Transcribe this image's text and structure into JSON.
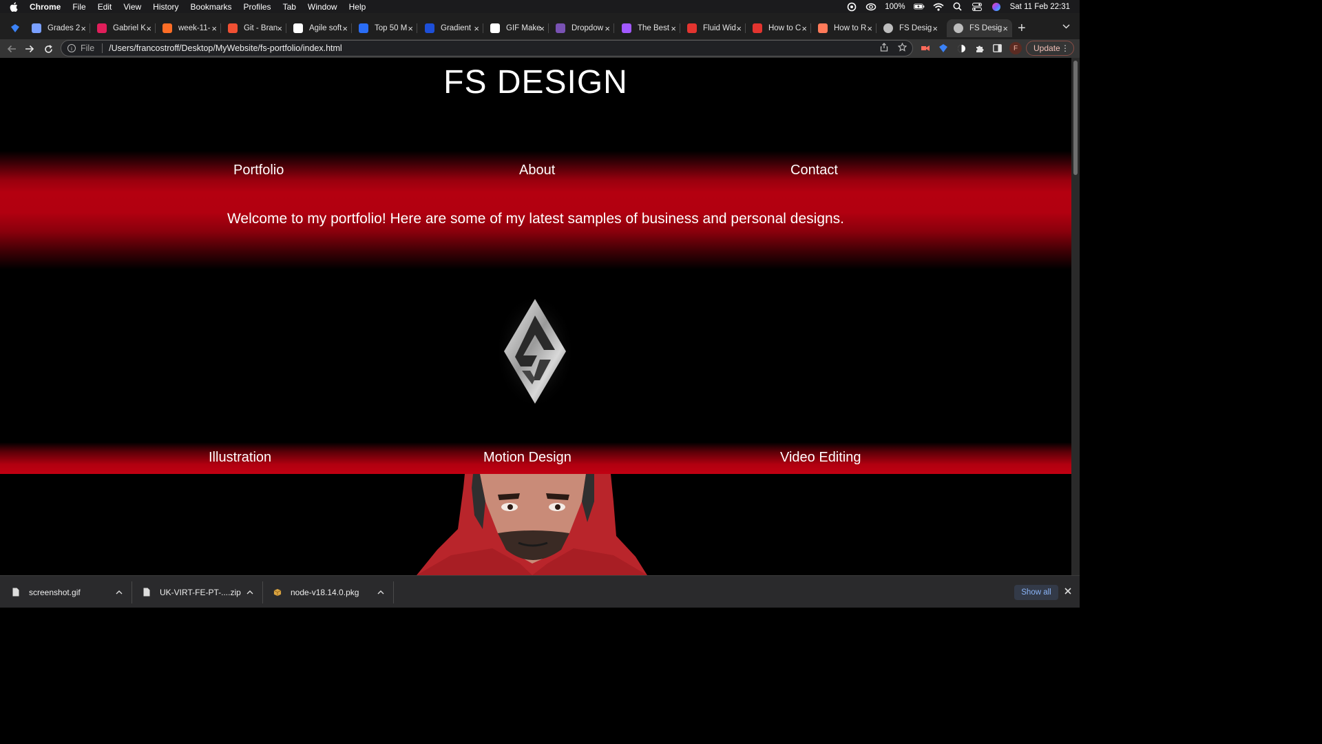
{
  "menubar": {
    "app": "Chrome",
    "items": [
      "File",
      "Edit",
      "View",
      "History",
      "Bookmarks",
      "Profiles",
      "Tab",
      "Window",
      "Help"
    ],
    "battery": "100%",
    "datetime": "Sat 11 Feb  22:31"
  },
  "tabs": [
    {
      "title": "Grades 2",
      "icon": "ox-icon",
      "color": "#7aa0ff"
    },
    {
      "title": "Gabriel K",
      "icon": "slack-icon",
      "color": "#e01e5a"
    },
    {
      "title": "week-11-",
      "icon": "gitlab-icon",
      "color": "#fc6d26"
    },
    {
      "title": "Git - Bran",
      "icon": "git-icon",
      "color": "#f05033"
    },
    {
      "title": "Agile soft",
      "icon": "wikipedia-icon",
      "color": "#ffffff"
    },
    {
      "title": "Top 50 M",
      "icon": "q-icon",
      "color": "#2a6df5"
    },
    {
      "title": "Gradient",
      "icon": "gradient-icon",
      "color": "#1d4fd8"
    },
    {
      "title": "GIF Make",
      "icon": "doc-icon",
      "color": "#ffffff"
    },
    {
      "title": "Dropdow",
      "icon": "bootstrap-icon",
      "color": "#7952b3"
    },
    {
      "title": "The Best",
      "icon": "figma-icon",
      "color": "#a259ff"
    },
    {
      "title": "Fluid Wid",
      "icon": "asterisk-icon",
      "color": "#e3342f"
    },
    {
      "title": "How to C",
      "icon": "pdf-icon",
      "color": "#e3342f"
    },
    {
      "title": "How to R",
      "icon": "hubspot-icon",
      "color": "#ff7a59"
    },
    {
      "title": "FS Desig",
      "icon": "globe-icon",
      "color": "#bdbdbd"
    },
    {
      "title": "FS Desig",
      "icon": "globe-icon",
      "color": "#bdbdbd"
    }
  ],
  "toolbar": {
    "scheme": "File",
    "url": "/Users/francostroff/Desktop/MyWebsite/fs-portfolio/index.html",
    "profile_initial": "F",
    "update_label": "Update"
  },
  "page": {
    "title": "FS DESIGN",
    "nav": [
      "Portfolio",
      "About",
      "Contact"
    ],
    "welcome": "Welcome to my portfolio! Here are some of my latest samples of business and personal designs.",
    "categories": [
      "Illustration",
      "Motion Design",
      "Video Editing"
    ]
  },
  "downloads": {
    "items": [
      "screenshot.gif",
      "UK-VIRT-FE-PT-....zip",
      "node-v18.14.0.pkg"
    ],
    "show_all": "Show all"
  }
}
